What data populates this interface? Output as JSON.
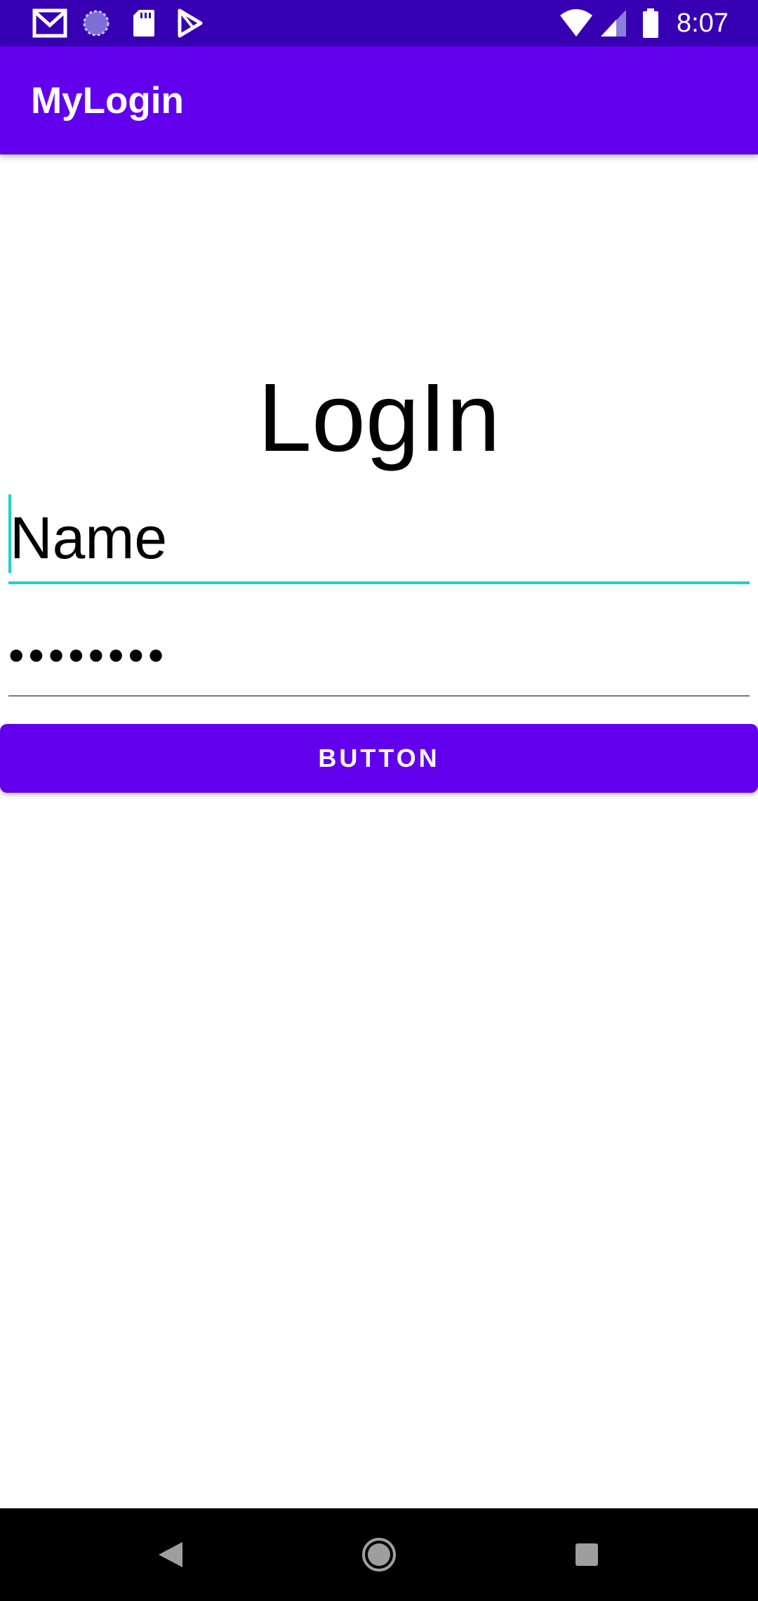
{
  "status_bar": {
    "time": "8:07",
    "icons": [
      "gmail-icon",
      "sync-icon",
      "sd-card-icon",
      "play-store-icon",
      "wifi-icon",
      "cellular-signal-icon",
      "battery-icon"
    ]
  },
  "app_bar": {
    "title": "MyLogin"
  },
  "main": {
    "heading": "LogIn",
    "name_field": {
      "value": "Name"
    },
    "password_field": {
      "value": "••••••••"
    },
    "button_label": "BUTTON"
  },
  "nav_bar": {
    "icons": [
      "back-icon",
      "home-icon",
      "recents-icon"
    ]
  },
  "colors": {
    "status_bar": "#3700b3",
    "primary": "#6200ee",
    "accent": "#1fd1c5"
  }
}
